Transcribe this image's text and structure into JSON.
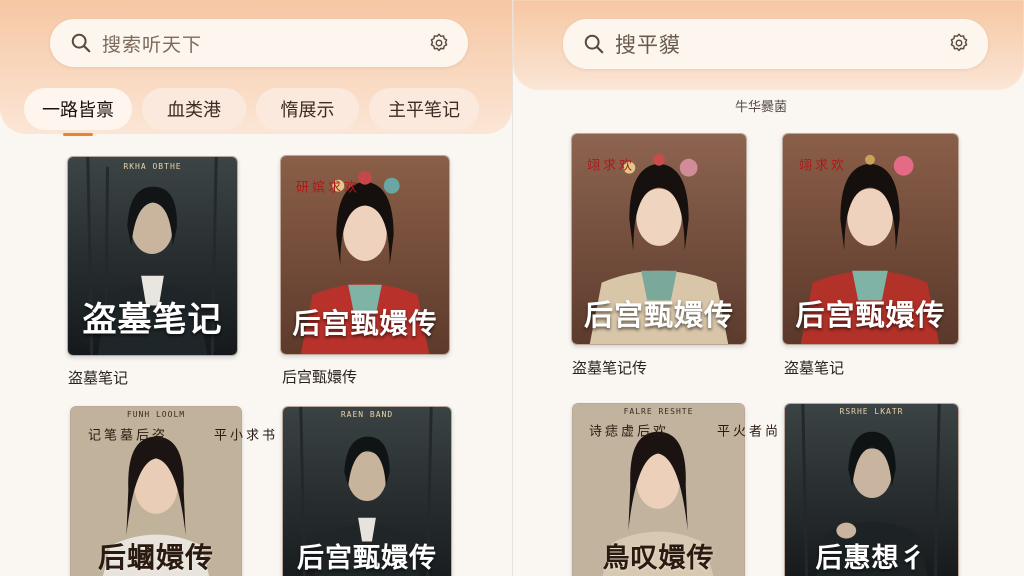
{
  "left": {
    "search": {
      "placeholder": "搜索听天下"
    },
    "tabs": [
      {
        "label": "一路皆禀"
      },
      {
        "label": "血类港"
      },
      {
        "label": "惰展示"
      },
      {
        "label": "主平笔记"
      }
    ],
    "cards": [
      {
        "caption": "盗墓笔记",
        "poster_title": "盗墓笔记",
        "poster_top": "RKHA OBTHE"
      },
      {
        "caption": "后宫甄嬛传",
        "poster_title": "后宫甄嬛传",
        "poster_side": "欢求嫔研"
      },
      {
        "caption": "",
        "poster_title": "后蟈嬛传",
        "poster_top": "FUNH LOOLM",
        "poster_side_left": "盗后墓笔记",
        "poster_side_right": "书求小平"
      },
      {
        "caption": "",
        "poster_title": "后宫甄嬛传",
        "poster_top": "RAEN BAND"
      }
    ]
  },
  "right": {
    "search": {
      "placeholder": "搜平貘"
    },
    "section_label": "牛华爨菌",
    "cards": [
      {
        "caption": "盗墓笔记传",
        "poster_title": "后宫甄嬛传",
        "poster_side": "欢求翊"
      },
      {
        "caption": "盗墓笔记",
        "poster_title": "后宫甄嬛传",
        "poster_side": "欢求翊"
      },
      {
        "caption": "",
        "poster_title": "鳥叹嬛传",
        "poster_top": "FALRE RESHTE",
        "poster_side_left": "欢后虚痣诗",
        "poster_side_right": "尚者火平"
      },
      {
        "caption": "",
        "poster_title": "后惠想彳",
        "poster_top": "RSRHE LKATR"
      }
    ]
  },
  "colors": {
    "accent": "#e8862f",
    "header_peach": "#f6c7a3"
  },
  "icons": [
    "search-icon",
    "settings-gear-icon"
  ]
}
